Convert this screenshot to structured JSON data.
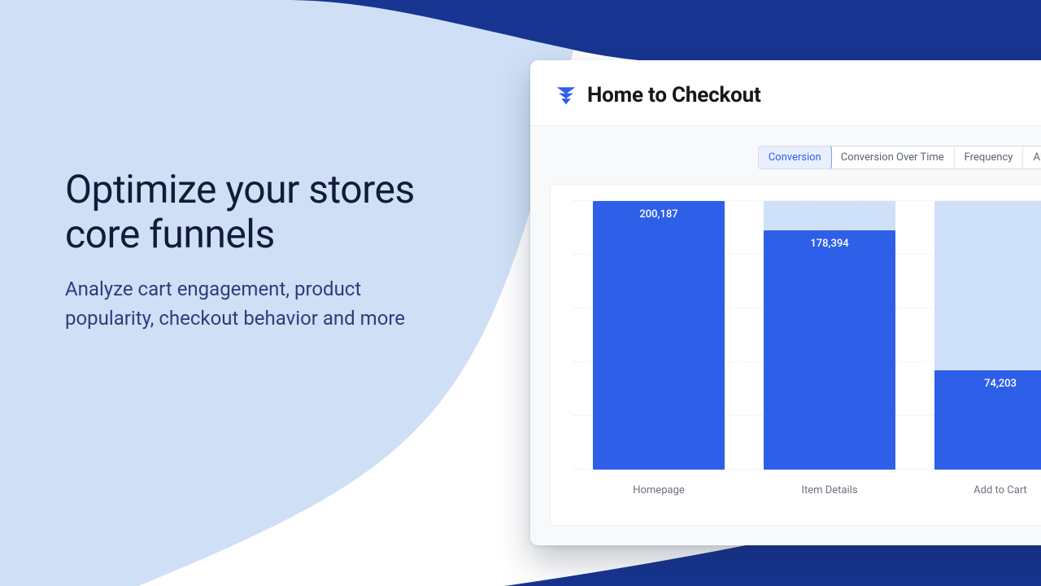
{
  "marketing": {
    "headline": "Optimize your stores core funnels",
    "subline": "Analyze cart engagement, product popularity, checkout behavior and more"
  },
  "card": {
    "title": "Home to Checkout",
    "tabs": [
      {
        "label": "Conversion",
        "active": true
      },
      {
        "label": "Conversion Over Time",
        "active": false
      },
      {
        "label": "Frequency",
        "active": false
      },
      {
        "label": "AB Test",
        "active": false
      }
    ]
  },
  "chart_data": {
    "type": "bar",
    "title": "Home to Checkout",
    "categories": [
      "Homepage",
      "Item Details",
      "Add to Cart"
    ],
    "values": [
      200187,
      178394,
      74203
    ],
    "value_labels": [
      "200,187",
      "178,394",
      "74,203"
    ],
    "ghost_values": [
      200187,
      200187,
      200187
    ],
    "ylim": [
      0,
      200187
    ],
    "xlabel": "",
    "ylabel": ""
  },
  "colors": {
    "brand": "#2e5fe8",
    "brand_light": "#cfe0f9",
    "bg_light": "#cfe0f6",
    "bg_dark": "#173591"
  }
}
